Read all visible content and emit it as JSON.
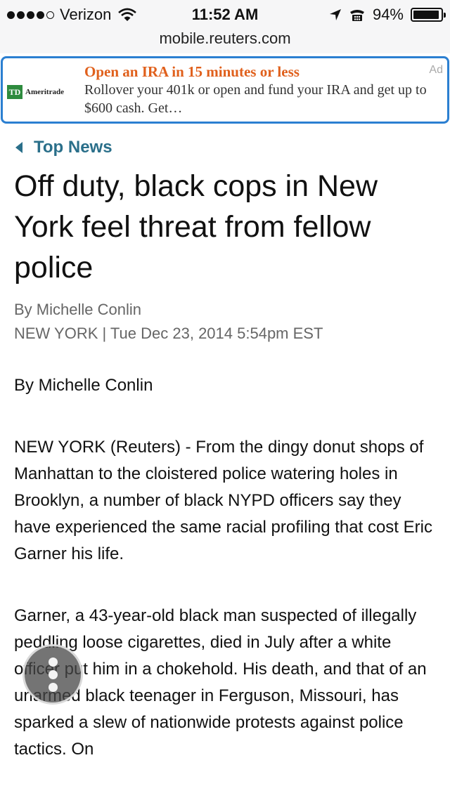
{
  "status_bar": {
    "carrier": "Verizon",
    "time": "11:52 AM",
    "battery_text": "94%",
    "battery_level": 0.94,
    "signal_bars_filled": 4,
    "signal_bars_total": 5
  },
  "url_bar": {
    "url": "mobile.reuters.com"
  },
  "ad": {
    "title": "Open an IRA in 15 minutes or less",
    "description": "Rollover your 401k or open and fund your IRA and get up to $600 cash. Get…",
    "label": "Ad",
    "logo_mark": "TD",
    "logo_name": "Ameritrade",
    "title_color": "#e0601c",
    "border_color": "#2b7fd1"
  },
  "article": {
    "back_label": "Top News",
    "headline": "Off duty, black cops in New York feel threat from fellow police",
    "byline": "By Michelle Conlin",
    "dateline": "NEW YORK | Tue Dec 23, 2014 5:54pm EST",
    "body_byline": "By Michelle Conlin",
    "paragraphs": [
      "NEW YORK (Reuters) - From the dingy donut shops of Manhattan to the cloistered police watering holes in Brooklyn, a number of black NYPD officers say they have experienced the same racial profiling that cost Eric Garner his life.",
      "Garner, a 43-year-old black man suspected of illegally peddling loose cigarettes, died in July after a white officer put him in a chokehold. His death, and that of an unarmed black teenager in Ferguson, Missouri, has sparked a slew of nationwide protests against police tactics. On"
    ],
    "link_color": "#2a6f8a"
  },
  "icons": {
    "wifi": "wifi-icon",
    "location": "location-arrow-icon",
    "alarm": "alarm-icon",
    "battery": "battery-icon",
    "back": "back-arrow-icon",
    "assistive_touch": "assistive-touch-icon"
  }
}
